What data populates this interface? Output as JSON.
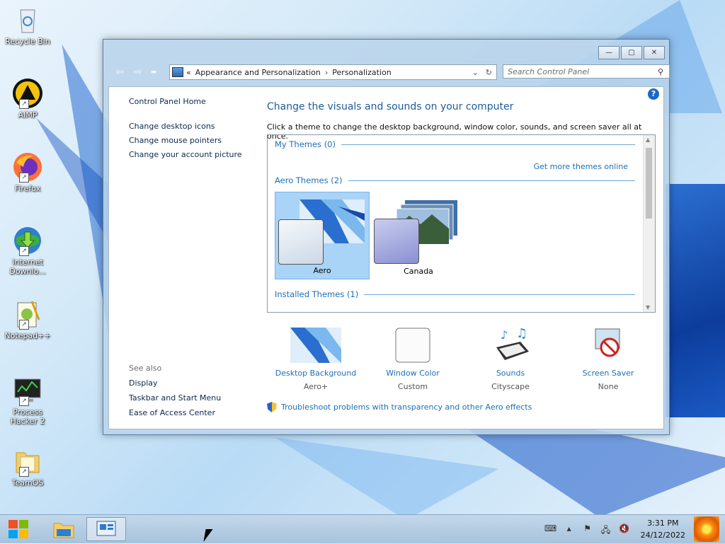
{
  "desktop": {
    "icons": [
      {
        "label": "Recycle Bin"
      },
      {
        "label": "AIMP"
      },
      {
        "label": "Firefox"
      },
      {
        "label": "Internet Downlo..."
      },
      {
        "label": "Notepad++"
      },
      {
        "label": "Process Hacker 2"
      },
      {
        "label": "TeamOS"
      }
    ]
  },
  "window": {
    "breadcrumb": {
      "overflow": "«",
      "parent": "Appearance and Personalization",
      "separator": "›",
      "current": "Personalization"
    },
    "search": {
      "placeholder": "Search Control Panel"
    },
    "caption_buttons": {
      "minimize": "▭",
      "maximize": "◻",
      "close": "✕"
    }
  },
  "left_nav": {
    "home": "Control Panel Home",
    "links": [
      "Change desktop icons",
      "Change mouse pointers",
      "Change your account picture"
    ],
    "see_also_header": "See also",
    "see_also": [
      "Display",
      "Taskbar and Start Menu",
      "Ease of Access Center"
    ]
  },
  "main": {
    "title": "Change the visuals and sounds on your computer",
    "description": "Click a theme to change the desktop background, window color, sounds, and screen saver all at once.",
    "groups": {
      "my_themes": "My Themes (0)",
      "aero_themes": "Aero Themes (2)",
      "installed_themes": "Installed Themes (1)"
    },
    "get_more": "Get more themes online",
    "themes": [
      {
        "name": "Aero",
        "selected": true
      },
      {
        "name": "Canada",
        "selected": false
      }
    ]
  },
  "settings": [
    {
      "title": "Desktop Background",
      "value": "Aero+",
      "icon": "desktop-background-icon"
    },
    {
      "title": "Window Color",
      "value": "Custom",
      "icon": "window-color-icon"
    },
    {
      "title": "Sounds",
      "value": "Cityscape",
      "icon": "sounds-icon"
    },
    {
      "title": "Screen Saver",
      "value": "None",
      "icon": "screen-saver-icon"
    }
  ],
  "troubleshoot": "Troubleshoot problems with transparency and other Aero effects",
  "taskbar": {
    "time": "3:31 PM",
    "date": "24/12/2022"
  },
  "colors": {
    "link_blue": "#1d6fb8",
    "title_blue": "#1e5c9a",
    "selection": "#a9d3f7"
  }
}
